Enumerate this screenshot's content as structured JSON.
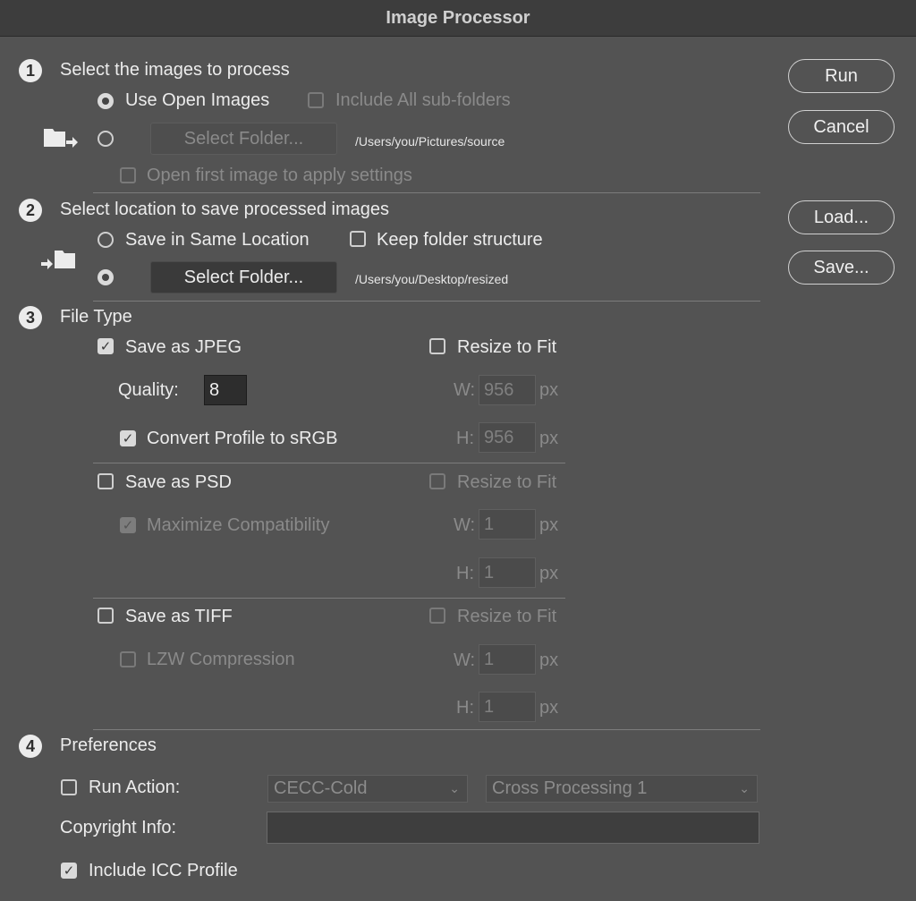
{
  "window": {
    "title": "Image Processor"
  },
  "buttons": {
    "run": "Run",
    "cancel": "Cancel",
    "load": "Load...",
    "save": "Save..."
  },
  "section1": {
    "number": "1",
    "title": "Select the images to process",
    "use_open_images": "Use Open Images",
    "include_subfolders": "Include All sub-folders",
    "select_folder": "Select Folder...",
    "source_path": "/Users/you/Pictures/source",
    "open_first_image": "Open first image to apply settings"
  },
  "section2": {
    "number": "2",
    "title": "Select location to save processed images",
    "save_same_location": "Save in Same Location",
    "keep_folder_structure": "Keep folder structure",
    "select_folder": "Select Folder...",
    "dest_path": "/Users/you/Desktop/resized"
  },
  "section3": {
    "number": "3",
    "title": "File Type",
    "jpeg": {
      "label": "Save as JPEG",
      "checked": true,
      "resize_label": "Resize to Fit",
      "resize_checked": false,
      "quality_label": "Quality:",
      "quality_value": "8",
      "convert_profile": "Convert Profile to sRGB",
      "convert_checked": true,
      "w_label": "W:",
      "w_value": "956",
      "h_label": "H:",
      "h_value": "956",
      "unit": "px"
    },
    "psd": {
      "label": "Save as PSD",
      "checked": false,
      "resize_label": "Resize to Fit",
      "resize_checked": false,
      "maximize": "Maximize Compatibility",
      "maximize_checked": true,
      "w_label": "W:",
      "w_value": "1",
      "h_label": "H:",
      "h_value": "1",
      "unit": "px"
    },
    "tiff": {
      "label": "Save as TIFF",
      "checked": false,
      "resize_label": "Resize to Fit",
      "resize_checked": false,
      "lzw": "LZW Compression",
      "lzw_checked": false,
      "w_label": "W:",
      "w_value": "1",
      "h_label": "H:",
      "h_value": "1",
      "unit": "px"
    }
  },
  "section4": {
    "number": "4",
    "title": "Preferences",
    "run_action": "Run Action:",
    "run_action_checked": false,
    "action_set": "CECC-Cold",
    "action": "Cross Processing 1",
    "copyright_label": "Copyright Info:",
    "copyright_value": "",
    "include_icc": "Include ICC Profile",
    "include_icc_checked": true
  },
  "icons": {
    "checkmark": "✓",
    "chevron": "⌄"
  },
  "colors": {
    "background": "#535353",
    "titlebar": "#3d3d3d",
    "text": "#ececec",
    "disabled": "#8a8a8a"
  }
}
